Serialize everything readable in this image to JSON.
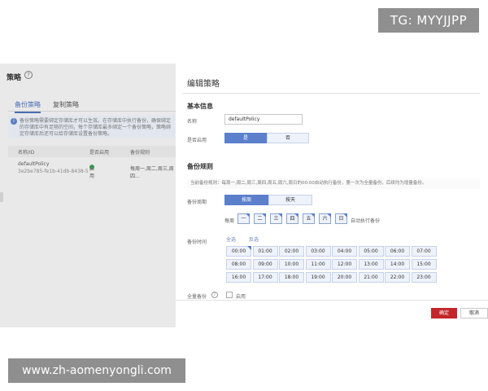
{
  "watermark_top": "TG: MYYJJPP",
  "watermark_bottom": "www.zh-aomenyongli.com",
  "left_page": {
    "title": "策略",
    "help": "?",
    "tabs": [
      "备份策略",
      "复制策略"
    ],
    "info_icon": "i",
    "info_text": "备份策略需要绑定存储库才可以生效。在存储库中执行备份，确保绑定的存储库中有足够的空间，每个存储库最多绑定一个备份策略，策略绑定存储库后还可以给存储库设置备份策略。",
    "table_headers": [
      "名称/ID",
      "是否启用",
      "备份规则"
    ],
    "row": {
      "name": "defaultPolicy",
      "id": "3e2be785-fe1b-41db-8438-5",
      "status": "启用",
      "rule": "每周一,周二,周三,周四..."
    },
    "colors": {
      "enabled_dot": "#3ca55c",
      "accent": "#4a6fb3"
    }
  },
  "dialog": {
    "title": "编辑策略",
    "basic_section": "基本信息",
    "name_label": "名称",
    "name_value": "defaultPolicy",
    "enable_label": "是否启用",
    "enable_options": [
      "是",
      "否"
    ],
    "enable_selected": "是",
    "rule_section": "备份规则",
    "rule_desc": "当前备份规则：每周一,周二,周三,周四,周五,周六,周日的00:00自动执行备份，第一次为全量备份，后续均为增量备份。",
    "cycle_label": "备份周期",
    "cycle_options": [
      "按周",
      "按天"
    ],
    "cycle_selected": "按周",
    "week_label": "每周",
    "weekdays": [
      "一",
      "二",
      "三",
      "四",
      "五",
      "六",
      "日"
    ],
    "week_hint": "自动执行备份",
    "time_label": "备份时间",
    "time_links": [
      "全选",
      "反选"
    ],
    "times": [
      "00:00",
      "01:00",
      "02:00",
      "03:00",
      "04:00",
      "05:00",
      "06:00",
      "07:00",
      "08:00",
      "09:00",
      "10:00",
      "11:00",
      "12:00",
      "13:00",
      "14:00",
      "15:00",
      "16:00",
      "17:00",
      "18:00",
      "19:00",
      "20:00",
      "21:00",
      "22:00",
      "23:00"
    ],
    "selected_time": "00:00",
    "full_backup_label": "全量备份",
    "full_backup_help": "?",
    "full_backup_option": "启用",
    "confirm_button": "确定",
    "cancel_button": "取消",
    "colors": {
      "primary": "#5b7fcb",
      "confirm": "#c3272b"
    }
  }
}
